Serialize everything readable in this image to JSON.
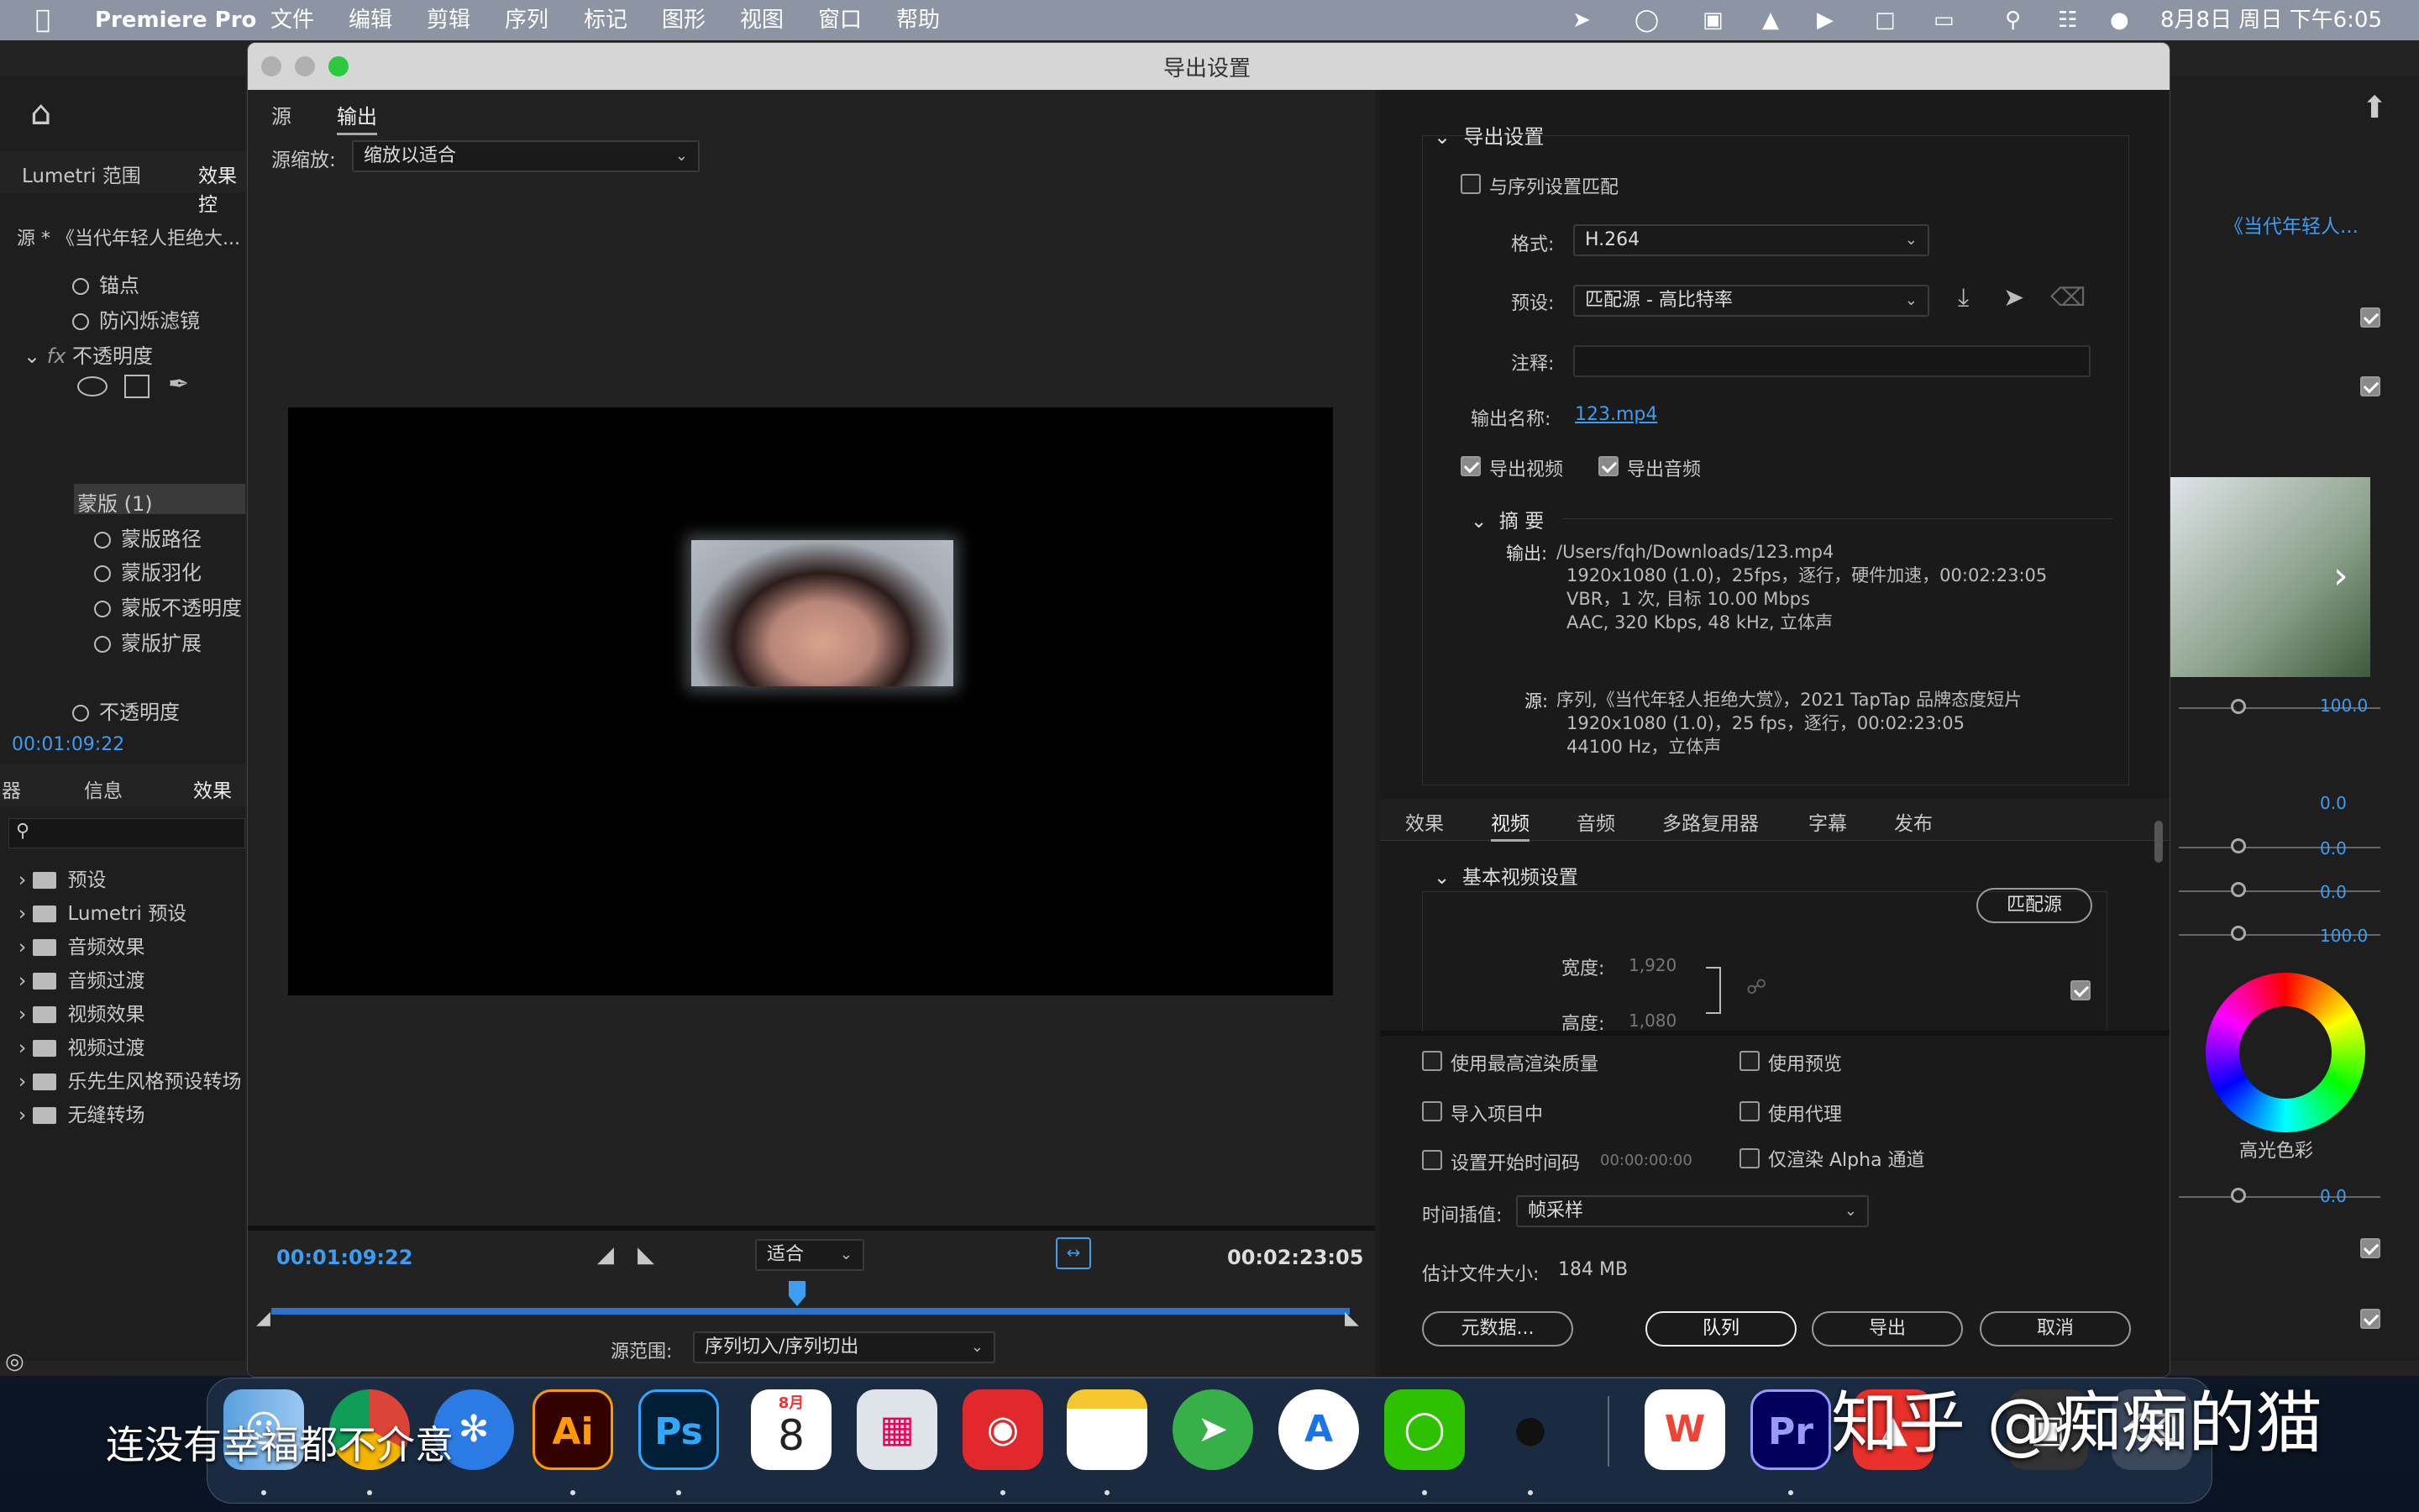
{
  "menubar": {
    "app": "Premiere Pro",
    "items": [
      "文件",
      "编辑",
      "剪辑",
      "序列",
      "标记",
      "图形",
      "视图",
      "窗口",
      "帮助"
    ],
    "clock": "8月8日 周日 下午6:05"
  },
  "dialog": {
    "title": "导出设置",
    "tab_source": "源",
    "tab_output": "输出",
    "source_scale_label": "源缩放:",
    "source_scale_value": "缩放以适合",
    "timecode_current": "00:01:09:22",
    "timecode_end": "00:02:23:05",
    "fit_value": "适合",
    "source_range_label": "源范围:",
    "source_range_value": "序列切入/序列切出"
  },
  "export": {
    "section_title": "导出设置",
    "match_sequence": "与序列设置匹配",
    "format_label": "格式:",
    "format_value": "H.264",
    "preset_label": "预设:",
    "preset_value": "匹配源 - 高比特率",
    "comment_label": "注释:",
    "comment_value": "",
    "output_name_label": "输出名称:",
    "output_name_value": "123.mp4",
    "export_video": "导出视频",
    "export_audio": "导出音频",
    "summary_title": "摘 要",
    "summary_output_label": "输出:",
    "summary_output_lines": [
      "/Users/fqh/Downloads/123.mp4",
      "1920x1080 (1.0)，25fps，逐行，硬件加速，00:02:23:05",
      "VBR，1 次, 目标 10.00 Mbps",
      "AAC, 320 Kbps, 48  kHz, 立体声"
    ],
    "summary_source_label": "源:",
    "summary_source_lines": [
      "序列,《当代年轻人拒绝大赏》，2021 TapTap 品牌态度短片",
      "1920x1080 (1.0)，25 fps，逐行，00:02:23:05",
      "44100 Hz，立体声"
    ],
    "tabs": [
      "效果",
      "视频",
      "音频",
      "多路复用器",
      "字幕",
      "发布"
    ],
    "basic_video_title": "基本视频设置",
    "match_source_btn": "匹配源",
    "width_label": "宽度:",
    "width_value": "1,920",
    "height_label": "高度:",
    "height_value": "1,080",
    "use_max_quality": "使用最高渲染质量",
    "use_preview": "使用预览",
    "import_project": "导入项目中",
    "use_proxy": "使用代理",
    "set_start_tc": "设置开始时间码",
    "start_tc_value": "00:00:00:00",
    "render_alpha": "仅渲染 Alpha 通道",
    "time_interp_label": "时间插值:",
    "time_interp_value": "帧采样",
    "file_size_label": "估计文件大小:",
    "file_size_value": "184 MB",
    "btn_metadata": "元数据...",
    "btn_queue": "队列",
    "btn_export": "导出",
    "btn_cancel": "取消"
  },
  "left_panel": {
    "tab_lumetri": "Lumetri 范围",
    "tab_effects": "效果控",
    "source_label": "源 * 《当代年轻人拒绝大...",
    "items": [
      "锚点",
      "防闪烁滤镜",
      "不透明度",
      "蒙版 (1)",
      "蒙版路径",
      "蒙版羽化",
      "蒙版不透明度",
      "蒙版扩展",
      "不透明度"
    ],
    "timecode": "00:01:09:22",
    "bottom_tabs": [
      "器",
      "信息",
      "效果"
    ],
    "effects_list": [
      "预设",
      "Lumetri 预设",
      "音频效果",
      "音频过渡",
      "视频效果",
      "视频过渡",
      "乐先生风格预设转场",
      "无缝转场"
    ]
  },
  "right_panel": {
    "clip_title": "《当代年轻人...",
    "values": [
      "100.0",
      "0.0",
      "0.0",
      "0.0",
      "100.0",
      "0.0"
    ],
    "color_wheel_label": "高光色彩"
  },
  "overlay": {
    "subtitle": "连没有幸福都不介意",
    "watermark": "知乎 @痴痴的猫"
  },
  "dock": {
    "calendar_month": "8月",
    "calendar_day": "8",
    "ai": "Ai",
    "ps": "Ps",
    "pr": "Pr"
  }
}
